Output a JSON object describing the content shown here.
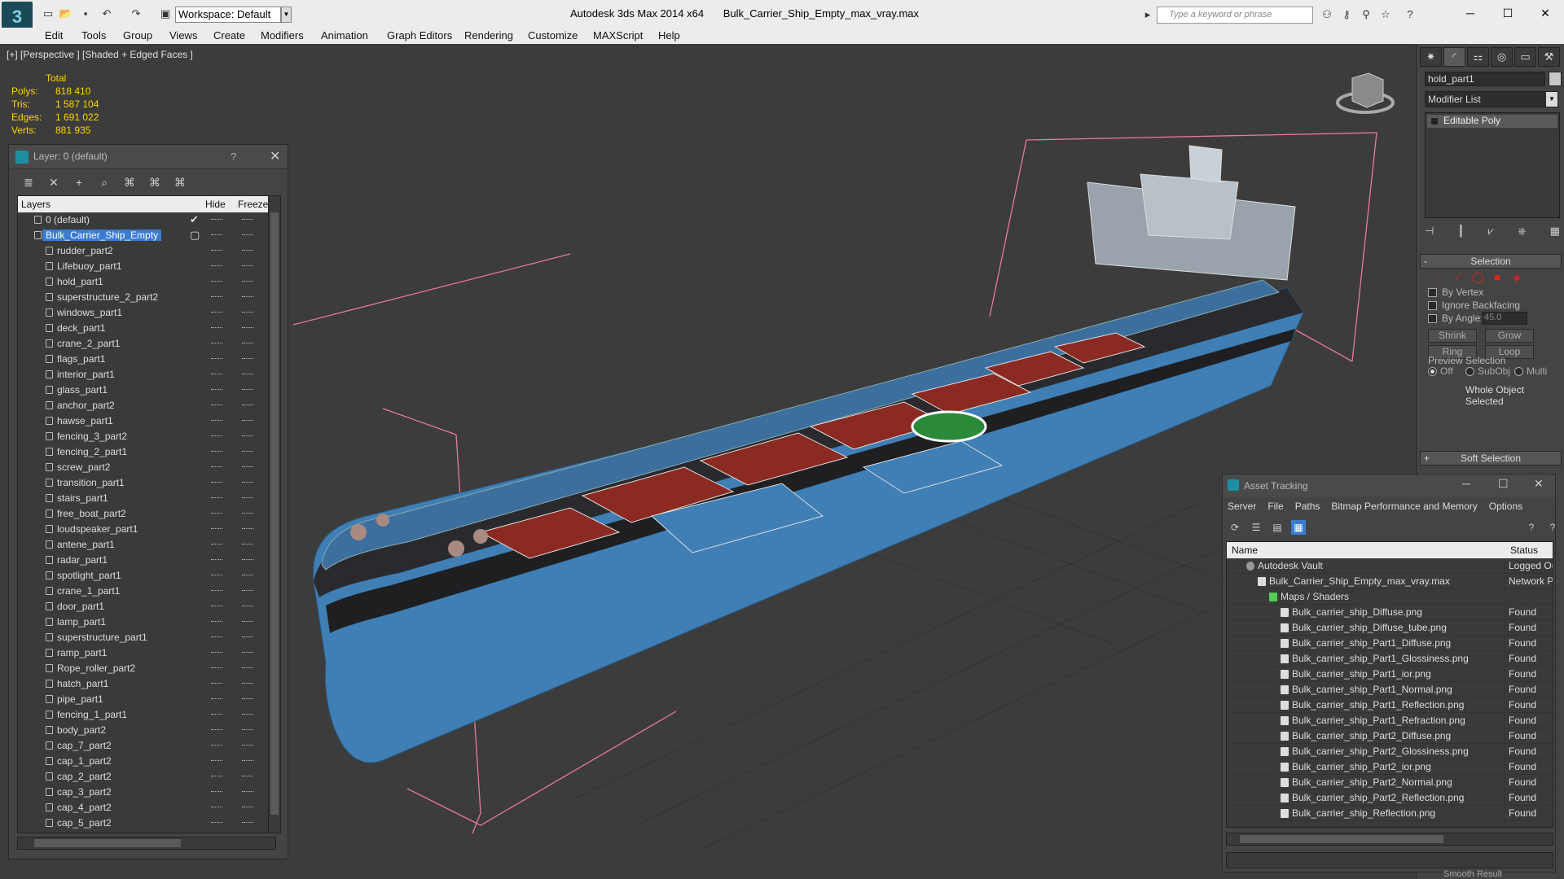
{
  "app": {
    "title": "Autodesk 3ds Max  2014 x64",
    "file": "Bulk_Carrier_Ship_Empty_max_vray.max",
    "workspace": "Workspace: Default",
    "search_placeholder": "Type a keyword or phrase"
  },
  "menu": [
    "Edit",
    "Tools",
    "Group",
    "Views",
    "Create",
    "Modifiers",
    "Animation",
    "Graph Editors",
    "Rendering",
    "Customize",
    "MAXScript",
    "Help"
  ],
  "viewport": {
    "label": "[+] [Perspective ] [Shaded + Edged Faces ]",
    "stats": {
      "header": "Total",
      "rows": [
        {
          "k": "Polys:",
          "v": "818 410"
        },
        {
          "k": "Tris:",
          "v": "1 587 104"
        },
        {
          "k": "Edges:",
          "v": "1 691 022"
        },
        {
          "k": "Verts:",
          "v": "881 935"
        }
      ]
    }
  },
  "command_panel": {
    "object_name": "hold_part1",
    "modifier_list": "Modifier List",
    "stack_item": "Editable Poly",
    "selection": {
      "title": "Selection",
      "by_vertex": "By Vertex",
      "ignore_backfacing": "Ignore Backfacing",
      "by_angle": "By Angle:",
      "angle_value": "45.0",
      "shrink": "Shrink",
      "grow": "Grow",
      "ring": "Ring",
      "loop": "Loop",
      "preview": "Preview Selection",
      "off": "Off",
      "subobj": "SubObj",
      "multi": "Multi",
      "whole": "Whole Object Selected"
    },
    "soft_selection": "Soft Selection"
  },
  "layer_window": {
    "title": "Layer: 0 (default)",
    "help": "?",
    "col_layers": "Layers",
    "col_hide": "Hide",
    "col_freeze": "Freeze",
    "default_layer": "0 (default)",
    "group": "Bulk_Carrier_Ship_Empty",
    "items": [
      "rudder_part2",
      "Lifebuoy_part1",
      "hold_part1",
      "superstructure_2_part2",
      "windows_part1",
      "deck_part1",
      "crane_2_part1",
      "flags_part1",
      "interior_part1",
      "glass_part1",
      "anchor_part2",
      "hawse_part1",
      "fencing_3_part2",
      "fencing_2_part1",
      "screw_part2",
      "transition_part1",
      "stairs_part1",
      "free_boat_part2",
      "loudspeaker_part1",
      "antene_part1",
      "radar_part1",
      "spotlight_part1",
      "crane_1_part1",
      "door_part1",
      "lamp_part1",
      "superstructure_part1",
      "ramp_part1",
      "Rope_roller_part2",
      "hatch_part1",
      "pipe_part1",
      "fencing_1_part1",
      "body_part2",
      "cap_7_part2",
      "cap_1_part2",
      "cap_2_part2",
      "cap_3_part2",
      "cap_4_part2",
      "cap_5_part2"
    ]
  },
  "asset_tracking": {
    "title": "Asset Tracking",
    "menu": [
      "Server",
      "File",
      "Paths",
      "Bitmap Performance and Memory",
      "Options"
    ],
    "col_name": "Name",
    "col_status": "Status",
    "rows": [
      {
        "name": "Autodesk Vault",
        "status": "Logged Ou",
        "indent": 1,
        "icon": "vault"
      },
      {
        "name": "Bulk_Carrier_Ship_Empty_max_vray.max",
        "status": "Network Pa",
        "indent": 2,
        "icon": "file"
      },
      {
        "name": "Maps / Shaders",
        "status": "",
        "indent": 3,
        "icon": "maps"
      },
      {
        "name": "Bulk_carrier_ship_Diffuse.png",
        "status": "Found",
        "indent": 4,
        "icon": "img"
      },
      {
        "name": "Bulk_carrier_ship_Diffuse_tube.png",
        "status": "Found",
        "indent": 4,
        "icon": "img"
      },
      {
        "name": "Bulk_carrier_ship_Part1_Diffuse.png",
        "status": "Found",
        "indent": 4,
        "icon": "img"
      },
      {
        "name": "Bulk_carrier_ship_Part1_Glossiness.png",
        "status": "Found",
        "indent": 4,
        "icon": "img"
      },
      {
        "name": "Bulk_carrier_ship_Part1_ior.png",
        "status": "Found",
        "indent": 4,
        "icon": "img"
      },
      {
        "name": "Bulk_carrier_ship_Part1_Normal.png",
        "status": "Found",
        "indent": 4,
        "icon": "img"
      },
      {
        "name": "Bulk_carrier_ship_Part1_Reflection.png",
        "status": "Found",
        "indent": 4,
        "icon": "img"
      },
      {
        "name": "Bulk_carrier_ship_Part1_Refraction.png",
        "status": "Found",
        "indent": 4,
        "icon": "img"
      },
      {
        "name": "Bulk_carrier_ship_Part2_Diffuse.png",
        "status": "Found",
        "indent": 4,
        "icon": "img"
      },
      {
        "name": "Bulk_carrier_ship_Part2_Glossiness.png",
        "status": "Found",
        "indent": 4,
        "icon": "img"
      },
      {
        "name": "Bulk_carrier_ship_Part2_ior.png",
        "status": "Found",
        "indent": 4,
        "icon": "img"
      },
      {
        "name": "Bulk_carrier_ship_Part2_Normal.png",
        "status": "Found",
        "indent": 4,
        "icon": "img"
      },
      {
        "name": "Bulk_carrier_ship_Part2_Reflection.png",
        "status": "Found",
        "indent": 4,
        "icon": "img"
      },
      {
        "name": "Bulk_carrier_ship_Reflection.png",
        "status": "Found",
        "indent": 4,
        "icon": "img"
      }
    ]
  },
  "footer": {
    "smooth": "Smooth Result"
  },
  "colors": {
    "hull": "#3f7fb5",
    "deck": "#3d6f9e",
    "hatch": "#8a2a22",
    "selection": "#3a7cd0",
    "bbox": "#e87a9a",
    "stats": "#ffd400"
  }
}
